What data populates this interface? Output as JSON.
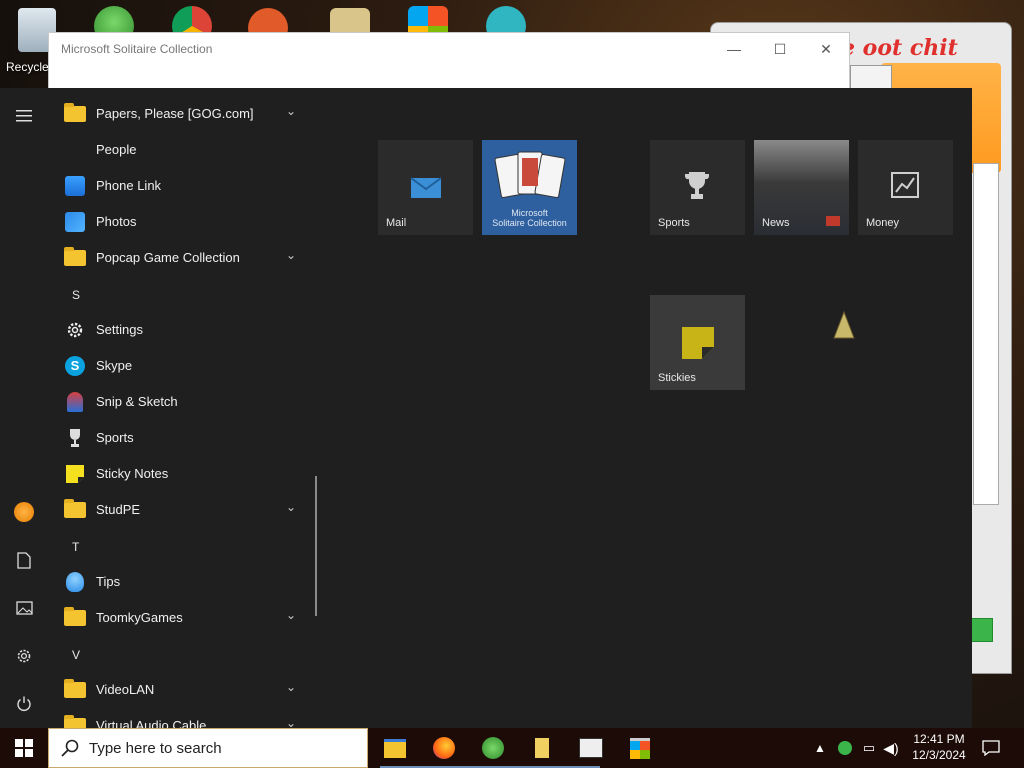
{
  "desktop": {
    "recycle_label": "Recycle"
  },
  "background_window": {
    "red_text": "e oot chit"
  },
  "solitaire_window": {
    "title": "Microsoft Solitaire Collection",
    "minimize": "—",
    "maximize": "☐",
    "close": "✕"
  },
  "start_menu": {
    "apps": [
      {
        "label": "Papers, Please [GOG.com]",
        "icon": "folder-icon",
        "folder": true
      },
      {
        "label": "People",
        "icon": "none"
      },
      {
        "label": "Phone Link",
        "icon": "phone-link-icon"
      },
      {
        "label": "Photos",
        "icon": "photos-icon"
      },
      {
        "label": "Popcap Game Collection",
        "icon": "folder-icon",
        "folder": true
      },
      {
        "label": "S",
        "letter": true
      },
      {
        "label": "Settings",
        "icon": "gear-icon"
      },
      {
        "label": "Skype",
        "icon": "skype-icon"
      },
      {
        "label": "Snip & Sketch",
        "icon": "snip-icon"
      },
      {
        "label": "Sports",
        "icon": "trophy-icon"
      },
      {
        "label": "Sticky Notes",
        "icon": "sticky-notes-icon"
      },
      {
        "label": "StudPE",
        "icon": "folder-icon",
        "folder": true
      },
      {
        "label": "T",
        "letter": true
      },
      {
        "label": "Tips",
        "icon": "tips-icon"
      },
      {
        "label": "ToomkyGames",
        "icon": "folder-icon",
        "folder": true
      },
      {
        "label": "V",
        "letter": true
      },
      {
        "label": "VideoLAN",
        "icon": "folder-icon",
        "folder": true
      },
      {
        "label": "Virtual Audio Cable",
        "icon": "folder-icon",
        "folder": true
      }
    ],
    "tiles": {
      "mail": "Mail",
      "solitaire_line1": "Microsoft",
      "solitaire_line2": "Solitaire Collection",
      "sports": "Sports",
      "news": "News",
      "money": "Money",
      "stickies": "Stickies"
    }
  },
  "taskbar": {
    "search_placeholder": "Type here to search",
    "time": "12:41 PM",
    "date": "12/3/2024"
  }
}
